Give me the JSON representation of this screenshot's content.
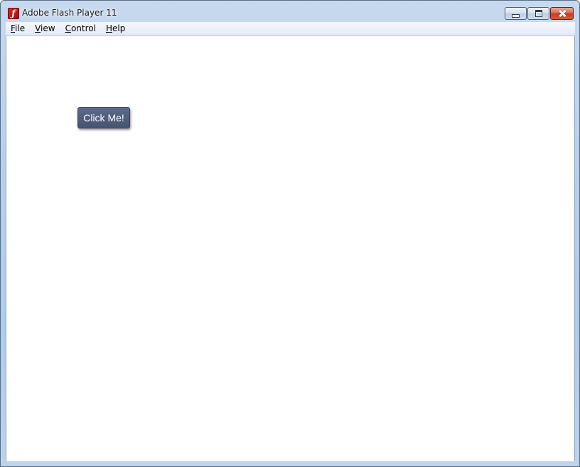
{
  "window": {
    "title": "Adobe Flash Player 11",
    "icon": "flash-player-icon"
  },
  "menubar": {
    "items": [
      {
        "label": "File",
        "accel": "F",
        "rest": "ile"
      },
      {
        "label": "View",
        "accel": "V",
        "rest": "iew"
      },
      {
        "label": "Control",
        "accel": "C",
        "rest": "ontrol"
      },
      {
        "label": "Help",
        "accel": "H",
        "rest": "elp"
      }
    ]
  },
  "content": {
    "button_label": "Click Me!"
  },
  "colors": {
    "button_background": "#4d5a78",
    "close_button": "#c53a1f",
    "frame": "#b9d1ea"
  }
}
